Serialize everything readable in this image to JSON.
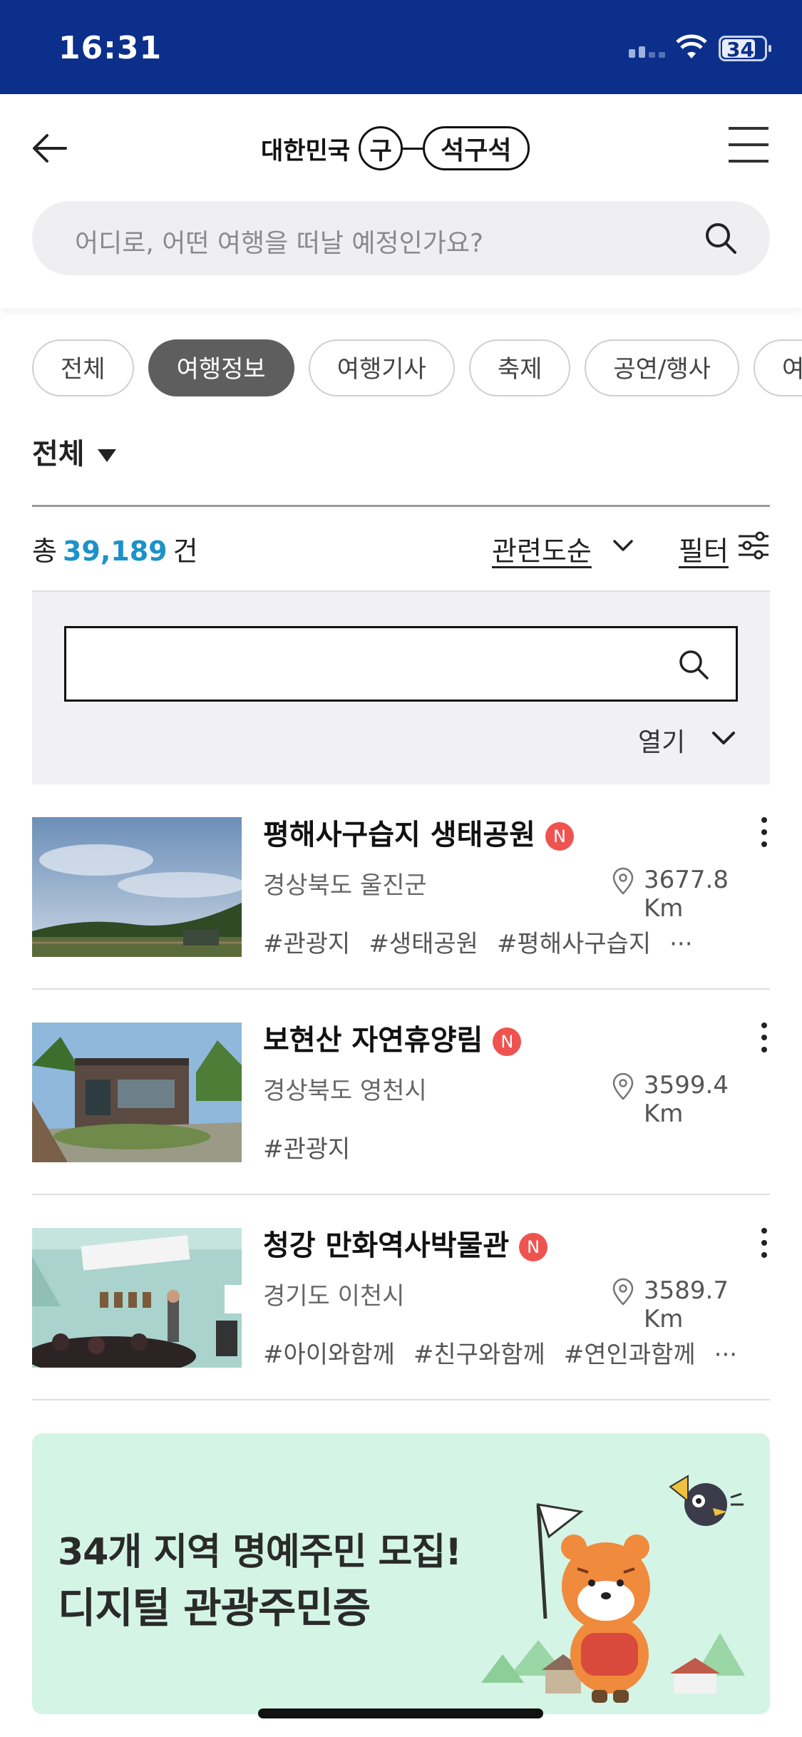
{
  "status_bar": {
    "time": "16:31",
    "battery": "34"
  },
  "header": {
    "logo_text": "대한민국",
    "logo_circle": "구",
    "logo_pill": "석구석",
    "search_placeholder": "어디로, 어떤 여행을 떠날 예정인가요?"
  },
  "chips": [
    {
      "label": "전체",
      "active": false
    },
    {
      "label": "여행정보",
      "active": true
    },
    {
      "label": "여행기사",
      "active": false
    },
    {
      "label": "축제",
      "active": false
    },
    {
      "label": "공연/행사",
      "active": false
    },
    {
      "label": "여",
      "active": false
    }
  ],
  "category": {
    "label": "전체"
  },
  "results": {
    "prefix": "총",
    "count": "39,189",
    "suffix": "건",
    "sort_label": "관련도순",
    "filter_label": "필터"
  },
  "panel": {
    "open_label": "열기"
  },
  "items": [
    {
      "title": "평해사구습지 생태공원",
      "badge": "N",
      "region": "경상북도 울진군",
      "distance": "3677.8 Km",
      "tags": [
        "#관광지",
        "#생태공원",
        "#평해사구습지",
        "···"
      ]
    },
    {
      "title": "보현산 자연휴양림",
      "badge": "N",
      "region": "경상북도 영천시",
      "distance": "3599.4 Km",
      "tags": [
        "#관광지"
      ]
    },
    {
      "title": "청강 만화역사박물관",
      "badge": "N",
      "region": "경기도 이천시",
      "distance": "3589.7 Km",
      "tags": [
        "#아이와함께",
        "#친구와함께",
        "#연인과함께",
        "···"
      ]
    }
  ],
  "banner": {
    "line1": "34개 지역 명예주민 모집!",
    "line2": "디지털 관광주민증"
  }
}
